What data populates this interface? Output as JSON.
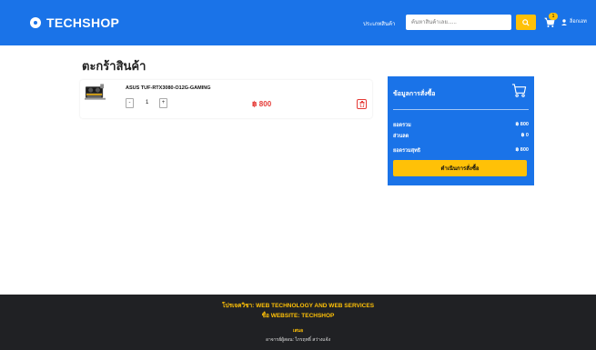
{
  "navbar": {
    "brand": "TECHSHOP",
    "category_label": "ประเภทสินค้า",
    "search_placeholder": "ค้นหาสินค้าเลย......",
    "cart_count": "1",
    "user_label": "ล็อกเอท"
  },
  "cart": {
    "title": "ตะกร้าสินค้า",
    "items": [
      {
        "name": "ASUS TUF-RTX3080-O12G-GAMING",
        "minus_label": "-",
        "quantity": "1",
        "plus_label": "+",
        "price": "฿ 800"
      }
    ]
  },
  "summary": {
    "title": "ข้อมูลการสั่งซื้อ",
    "rows": [
      {
        "label": "ยอดรวม",
        "value": "฿ 800"
      },
      {
        "label": "ส่วนลด",
        "value": "฿ 0"
      },
      {
        "label": "ยอดรวมสุทธิ",
        "value": "฿ 800"
      }
    ],
    "checkout_label": "ดำเนินการสั่งซื้อ"
  },
  "footer": {
    "line1": "โปรเจควิชา: WEB TECHNOLOGY AND WEB SERVICES",
    "line2": "ชื่อ WEBSITE: TECHSHOP",
    "line3": "เสนอ",
    "line4": "อาจารย์ผู้สอน: ไกรฤทธิ์ สว่างแจ้ง"
  },
  "colors": {
    "primary": "#1a73e8",
    "accent": "#ffc107",
    "price": "#e53935",
    "footer_bg": "#202124"
  },
  "icons": [
    "logo-icon",
    "search-icon",
    "cart-icon",
    "user-icon",
    "trash-icon",
    "product-image"
  ]
}
